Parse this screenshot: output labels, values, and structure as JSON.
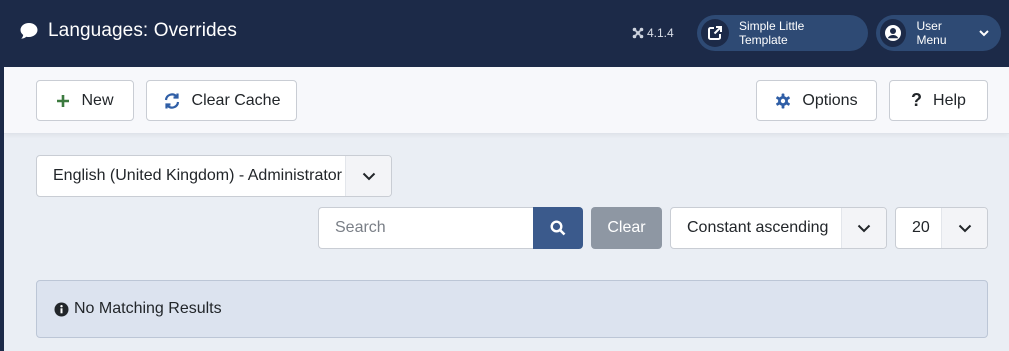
{
  "header": {
    "title": "Languages: Overrides",
    "version": "4.1.4",
    "template_link": "Simple Little Template",
    "user_menu": "User Menu"
  },
  "toolbar": {
    "new_label": "New",
    "clear_cache_label": "Clear Cache",
    "options_label": "Options",
    "help_label": "Help"
  },
  "filters": {
    "language_selected": "English (United Kingdom) - Administrator",
    "search_placeholder": "Search",
    "clear_label": "Clear",
    "sort_selected": "Constant ascending",
    "limit_selected": "20"
  },
  "alert": {
    "message": "No Matching Results"
  },
  "colors": {
    "header_bg": "#1c2a48",
    "pill_bg": "#2e4a74",
    "search_button": "#3b5a8c",
    "clear_button": "#8e97a3",
    "alert_bg": "#dce3ef",
    "new_icon": "#3c7a3f",
    "accent_blue": "#2f5ea6"
  }
}
